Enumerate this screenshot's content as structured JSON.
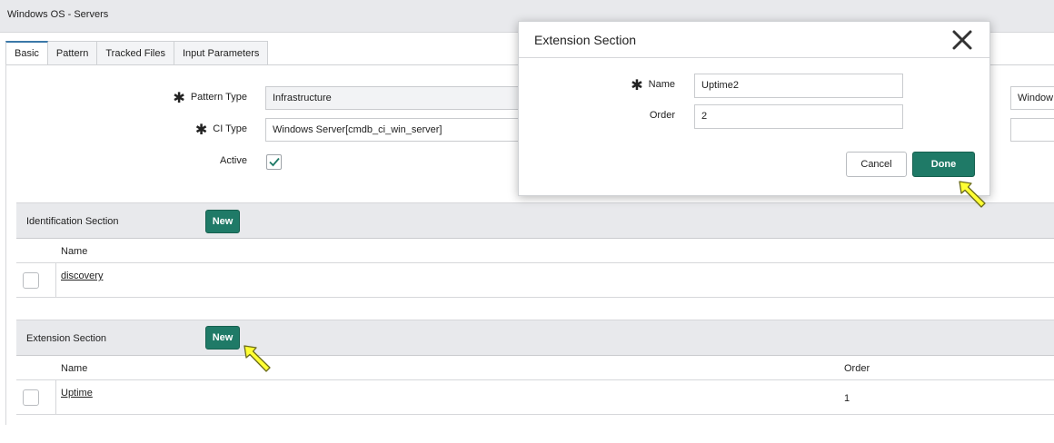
{
  "window": {
    "title": "Windows OS - Servers"
  },
  "tabs": [
    {
      "label": "Basic",
      "active": true
    },
    {
      "label": "Pattern",
      "active": false
    },
    {
      "label": "Tracked Files",
      "active": false
    },
    {
      "label": "Input Parameters",
      "active": false
    }
  ],
  "form": {
    "pattern_type": {
      "label": "Pattern Type",
      "value": "Infrastructure",
      "required": true
    },
    "ci_type": {
      "label": "CI Type",
      "value": "Windows Server[cmdb_ci_win_server]",
      "required": true
    },
    "active": {
      "label": "Active",
      "checked": true
    },
    "right_field_value": "Window"
  },
  "identification_section": {
    "label": "Identification Section",
    "new_label": "New",
    "columns": [
      "Name"
    ],
    "rows": [
      {
        "name": "discovery"
      }
    ]
  },
  "extension_section": {
    "label": "Extension Section",
    "new_label": "New",
    "columns": [
      "Name",
      "Order"
    ],
    "rows": [
      {
        "name": "Uptime",
        "order": "1"
      }
    ]
  },
  "modal": {
    "title": "Extension Section",
    "name_label": "Name",
    "name_value": "Uptime2",
    "order_label": "Order",
    "order_value": "2",
    "cancel_label": "Cancel",
    "done_label": "Done"
  },
  "colors": {
    "accent": "#1f7a67",
    "header_bg": "#e8e9ec",
    "pointer": "#ffff33"
  },
  "icons": {
    "close": "close-icon",
    "checkmark": "checkmark-icon",
    "pointer": "arrow-pointer-icon"
  }
}
